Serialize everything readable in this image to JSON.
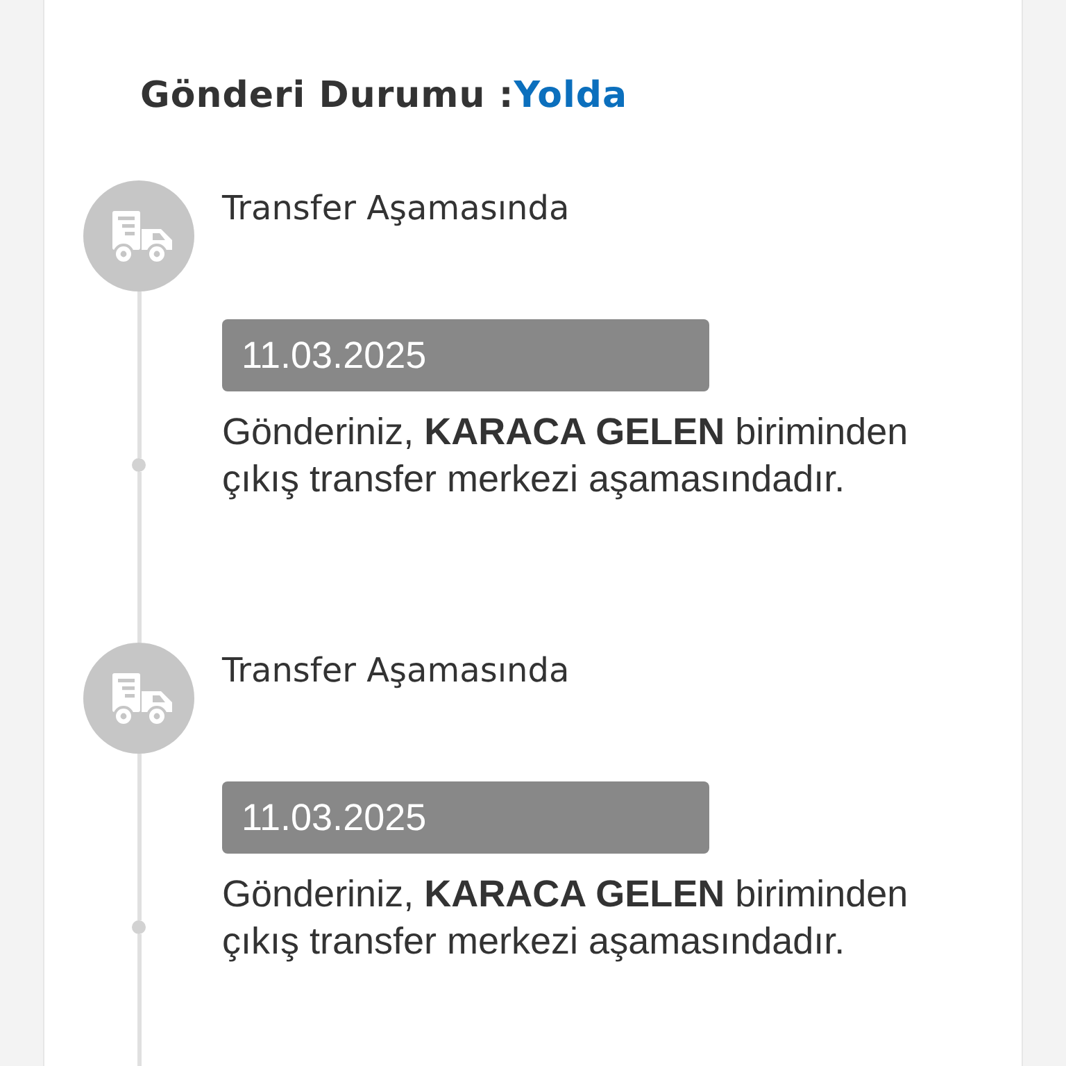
{
  "shipment_status": {
    "label": "Gönderi Durumu :",
    "value": "Yolda"
  },
  "timeline": [
    {
      "title": "Transfer Aşamasında",
      "date": "11.03.2025",
      "description": "Gönderiniz, **KARACA GELEN** biriminden çıkış transfer merkezi aşamasındadır."
    },
    {
      "title": "Transfer Aşamasında",
      "date": "11.03.2025",
      "description": "Gönderiniz, **KARACA GELEN** biriminden çıkış transfer merkezi aşamasındadır."
    }
  ]
}
